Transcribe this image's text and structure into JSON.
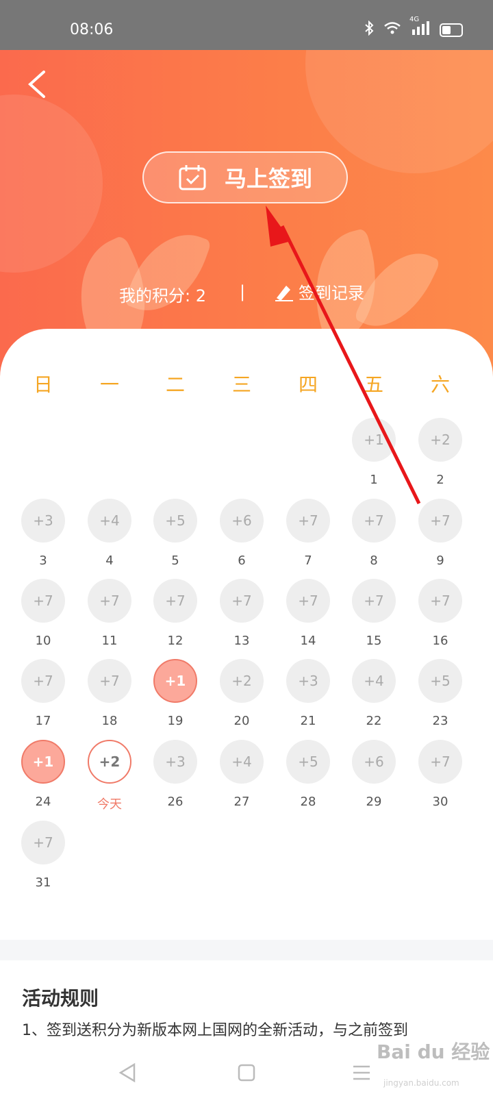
{
  "status_bar": {
    "time": "08:06",
    "network": "4G"
  },
  "header": {
    "back_icon": "chevron-left-icon",
    "checkin_button": "马上签到",
    "points_label": "我的积分: 2",
    "divider": "|",
    "records_label": "签到记录"
  },
  "colors": {
    "accent": "#fb6a4d",
    "weekday": "#f5a623",
    "signed": "#fca89a"
  },
  "calendar": {
    "weekdays": [
      "日",
      "一",
      "二",
      "三",
      "四",
      "五",
      "六"
    ],
    "days": [
      {
        "num": "1",
        "pts": "+1",
        "state": "normal"
      },
      {
        "num": "2",
        "pts": "+2",
        "state": "normal"
      },
      {
        "num": "3",
        "pts": "+3",
        "state": "normal"
      },
      {
        "num": "4",
        "pts": "+4",
        "state": "normal"
      },
      {
        "num": "5",
        "pts": "+5",
        "state": "normal"
      },
      {
        "num": "6",
        "pts": "+6",
        "state": "normal"
      },
      {
        "num": "7",
        "pts": "+7",
        "state": "normal"
      },
      {
        "num": "8",
        "pts": "+7",
        "state": "normal"
      },
      {
        "num": "9",
        "pts": "+7",
        "state": "normal"
      },
      {
        "num": "10",
        "pts": "+7",
        "state": "normal"
      },
      {
        "num": "11",
        "pts": "+7",
        "state": "normal"
      },
      {
        "num": "12",
        "pts": "+7",
        "state": "normal"
      },
      {
        "num": "13",
        "pts": "+7",
        "state": "normal"
      },
      {
        "num": "14",
        "pts": "+7",
        "state": "normal"
      },
      {
        "num": "15",
        "pts": "+7",
        "state": "normal"
      },
      {
        "num": "16",
        "pts": "+7",
        "state": "normal"
      },
      {
        "num": "17",
        "pts": "+7",
        "state": "normal"
      },
      {
        "num": "18",
        "pts": "+7",
        "state": "normal"
      },
      {
        "num": "19",
        "pts": "+1",
        "state": "signed"
      },
      {
        "num": "20",
        "pts": "+2",
        "state": "normal"
      },
      {
        "num": "21",
        "pts": "+3",
        "state": "normal"
      },
      {
        "num": "22",
        "pts": "+4",
        "state": "normal"
      },
      {
        "num": "23",
        "pts": "+5",
        "state": "normal"
      },
      {
        "num": "24",
        "pts": "+1",
        "state": "signed"
      },
      {
        "num": "今天",
        "pts": "+2",
        "state": "today"
      },
      {
        "num": "26",
        "pts": "+3",
        "state": "normal"
      },
      {
        "num": "27",
        "pts": "+4",
        "state": "normal"
      },
      {
        "num": "28",
        "pts": "+5",
        "state": "normal"
      },
      {
        "num": "29",
        "pts": "+6",
        "state": "normal"
      },
      {
        "num": "30",
        "pts": "+7",
        "state": "normal"
      },
      {
        "num": "31",
        "pts": "+7",
        "state": "normal"
      }
    ]
  },
  "rules": {
    "title": "活动规则",
    "text": "1、签到送积分为新版本网上国网的全新活动，与之前签到"
  },
  "watermark": {
    "brand": "Bai du 经验",
    "url": "jingyan.baidu.com"
  },
  "nav": {
    "back_icon": "nav-back-icon",
    "home_icon": "nav-home-icon",
    "menu_icon": "nav-menu-icon"
  }
}
